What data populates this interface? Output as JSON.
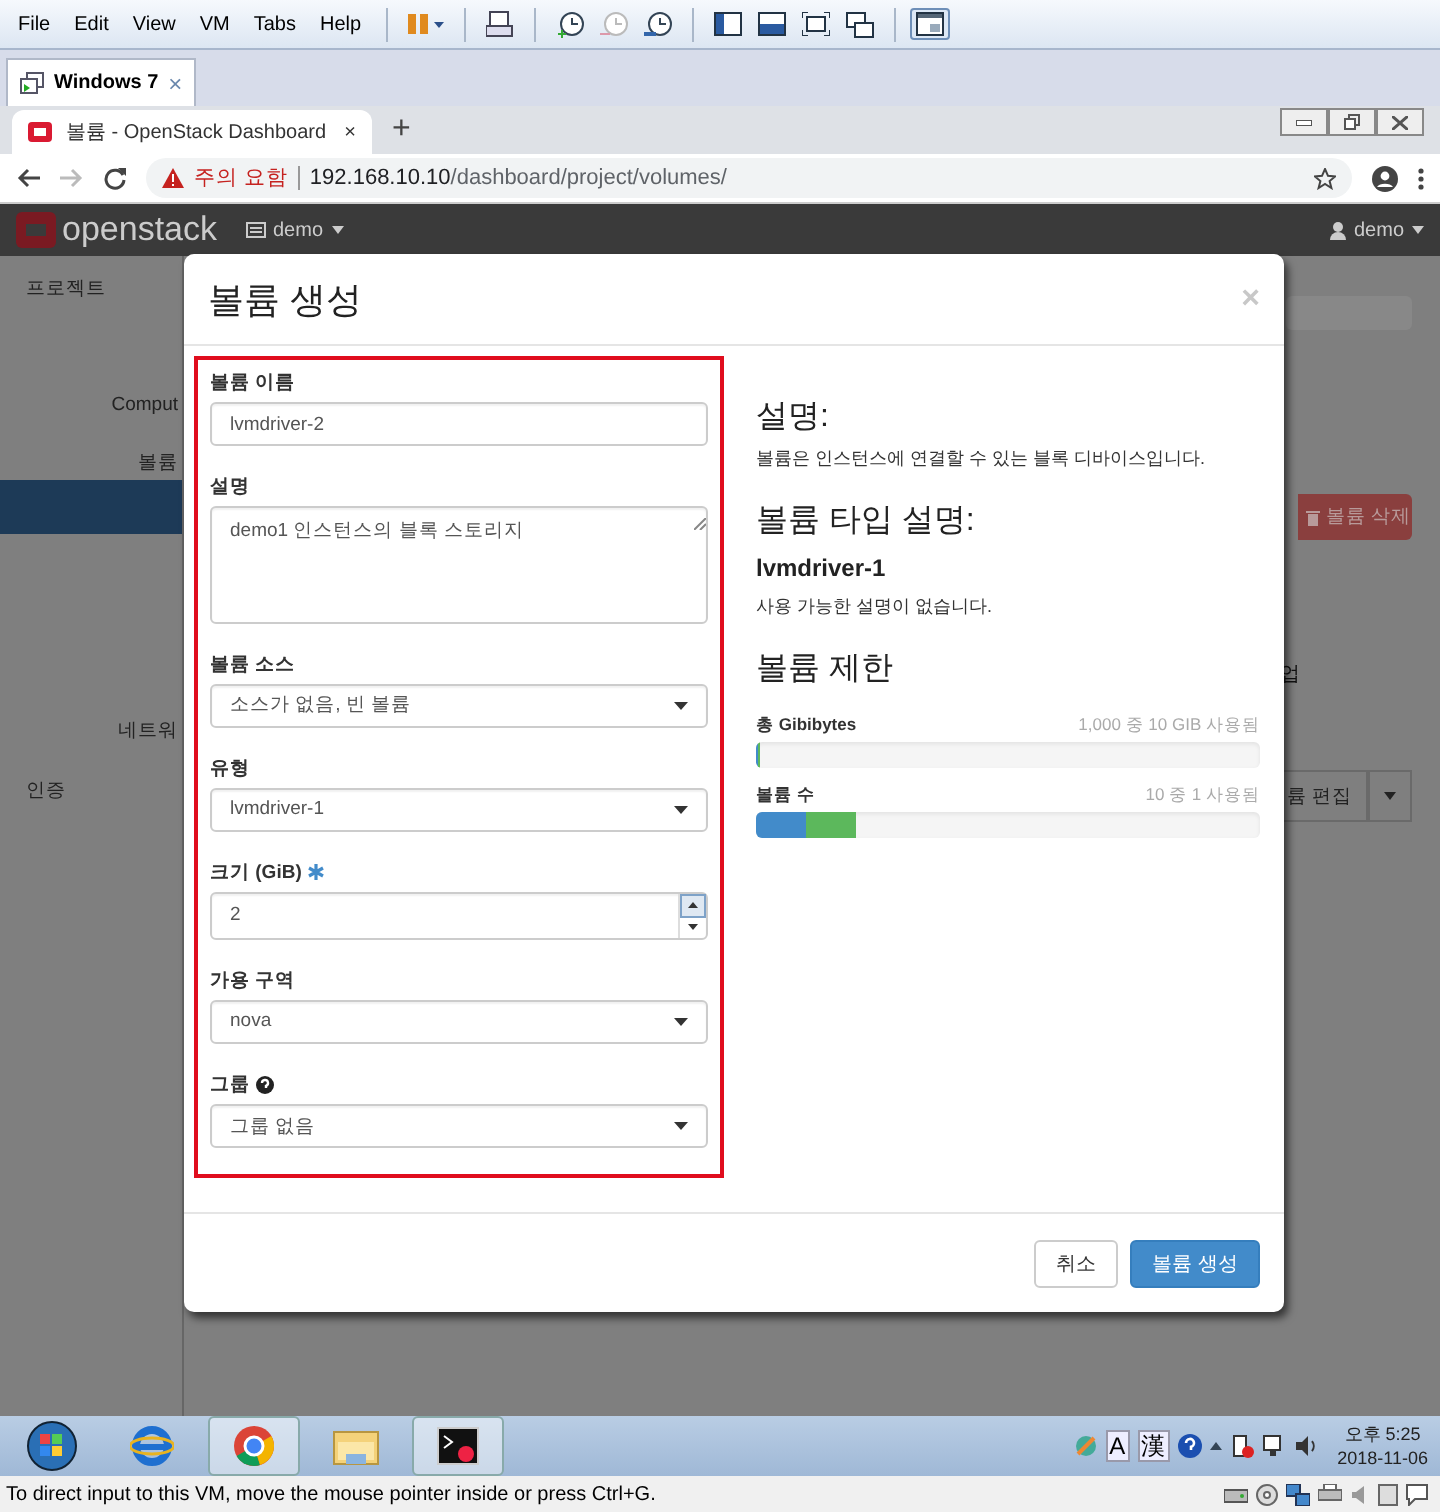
{
  "vm_menu": [
    "File",
    "Edit",
    "View",
    "VM",
    "Tabs",
    "Help"
  ],
  "vm_tab": {
    "title": "Windows 7",
    "close": "×"
  },
  "browser": {
    "tab_title": "볼륨 - OpenStack Dashboard",
    "tab_close": "×",
    "new_tab": "+",
    "security_label": "주의 요함",
    "url_host": "192.168.10.10",
    "url_path": "/dashboard/project/volumes/"
  },
  "header": {
    "logo": "openstack",
    "project": "demo",
    "user": "demo"
  },
  "sidebar": [
    {
      "label": "프로젝트",
      "kind": "section"
    },
    {
      "label": "Comput",
      "kind": "group"
    },
    {
      "label": "볼륨",
      "kind": "group"
    },
    {
      "label": "네트워",
      "kind": "group"
    },
    {
      "label": "인증",
      "kind": "section"
    }
  ],
  "page_actions": {
    "delete_button": "볼륨 삭제",
    "partial_text": "업",
    "edit_button": "륨 편집"
  },
  "modal": {
    "title": "볼륨 생성",
    "close": "×",
    "fields": [
      {
        "kind": "text",
        "label": "볼륨 이름",
        "value": "lvmdriver-2"
      },
      {
        "kind": "textarea",
        "label": "설명",
        "value": "demo1 인스턴스의 블록 스토리지"
      },
      {
        "kind": "select",
        "label": "볼륨 소스",
        "value": "소스가 없음, 빈 볼륨"
      },
      {
        "kind": "select",
        "label": "유형",
        "value": "lvmdriver-1"
      },
      {
        "kind": "number",
        "label": "크기 (GiB)",
        "required": true,
        "value": "2"
      },
      {
        "kind": "select",
        "label": "가용 구역",
        "value": "nova"
      },
      {
        "kind": "select",
        "label": "그룹",
        "help": true,
        "value": "그룹 없음"
      }
    ],
    "info": {
      "heading": "설명:",
      "text": "볼륨은 인스턴스에 연결할 수 있는 블록 디바이스입니다.",
      "type_heading": "볼륨 타입 설명:",
      "type_name": "lvmdriver-1",
      "type_text": "사용 가능한 설명이 없습니다.",
      "limits_heading": "볼륨 제한"
    },
    "limits": [
      {
        "label": "총 Gibibytes",
        "reading": "1,000 중 10 GIB 사용됨",
        "segments": [
          {
            "level": 0.004,
            "color": "#428bca"
          },
          {
            "level": 0.003,
            "color": "#5cb85c"
          }
        ]
      },
      {
        "label": "볼륨 수",
        "reading": "10 중 1 사용됨",
        "segments": [
          {
            "level": 0.1,
            "color": "#428bca"
          },
          {
            "level": 0.1,
            "color": "#5cb85c"
          }
        ]
      }
    ],
    "buttons": [
      {
        "label": "취소",
        "kind": "default"
      },
      {
        "label": "볼륨 생성",
        "kind": "primary"
      }
    ]
  },
  "taskbar": {
    "ime": [
      "A",
      "漢"
    ],
    "clock_time": "오후 5:25",
    "clock_date": "2018-11-06"
  },
  "status_bar": "To direct input to this VM, move the mouse pointer inside or press Ctrl+G."
}
